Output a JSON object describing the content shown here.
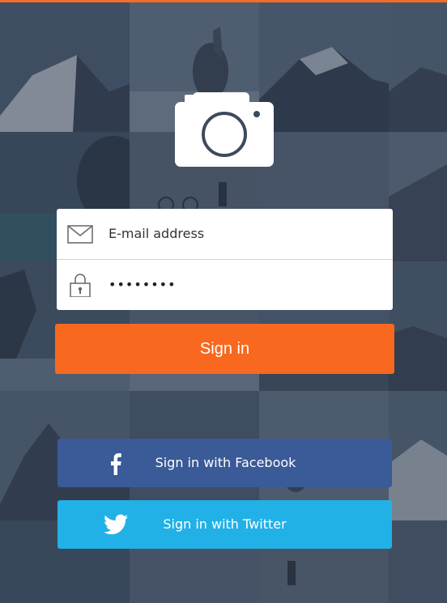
{
  "colors": {
    "accent": "#f8681e",
    "facebook": "#3a5a98",
    "twitter": "#22b1e6",
    "overlay": "#283448"
  },
  "logo": {
    "icon": "camera-icon"
  },
  "form": {
    "email": {
      "placeholder": "E-mail address",
      "icon": "envelope-icon"
    },
    "password": {
      "value": "••••••••",
      "icon": "padlock-icon"
    },
    "signin_label": "Sign in"
  },
  "social": {
    "facebook": {
      "label": "Sign in with Facebook",
      "icon": "facebook-icon"
    },
    "twitter": {
      "label": "Sign in with Twitter",
      "icon": "twitter-icon"
    }
  }
}
